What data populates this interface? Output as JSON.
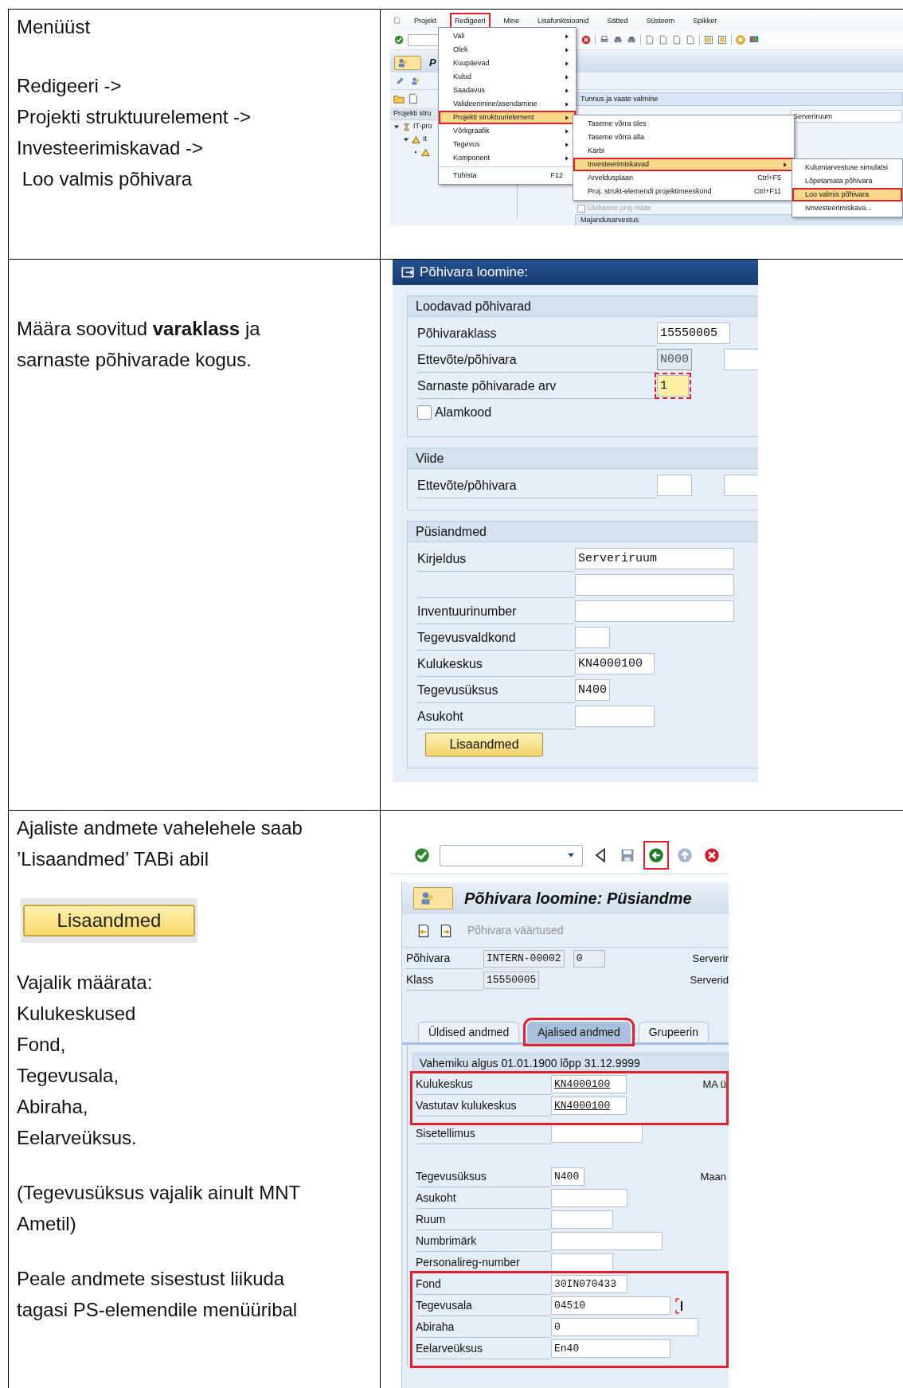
{
  "table": {
    "rows": [
      {
        "instruction": {
          "blocks": [
            {
              "kind": "paragraph",
              "lines": [
                "Menüüst"
              ]
            },
            {
              "kind": "paragraph",
              "lines": [
                "Redigeeri ->",
                "Projekti struktuurelement ->",
                "Investeerimiskavad ->",
                " Loo valmis põhivara"
              ]
            }
          ]
        },
        "screenshot": {
          "kind": "menu_path",
          "menubar": [
            {
              "label": "Projekt",
              "highlighted": false
            },
            {
              "label": "Redigeeri",
              "highlighted": true
            },
            {
              "label": "Mine",
              "highlighted": false
            },
            {
              "label": "Lisafunktsioonid",
              "highlighted": false
            },
            {
              "label": "Sätted",
              "highlighted": false
            },
            {
              "label": "Süsteem",
              "highlighted": false
            },
            {
              "label": "Spikker",
              "highlighted": false
            }
          ],
          "title_fragment": "P",
          "tab_label": "Tunnus ja vaate valmine",
          "tree_header": "Projekti stru",
          "tree": [
            {
              "kind": "node",
              "label": "IT-pro",
              "expanded": true,
              "children": [
                {
                  "kind": "node",
                  "label": "It",
                  "expanded": true,
                  "children": [
                    {
                      "kind": "leaf"
                    }
                  ]
                }
              ]
            }
          ],
          "field_value": "Serveriruum",
          "checkbox": {
            "label": "Ülekanne proj-määr.",
            "checked": false
          },
          "section_header": "Majandusarvestus",
          "menus": [
            {
              "items": [
                {
                  "kind": "item",
                  "label": "Vali",
                  "submenu": true,
                  "selected": false,
                  "highlighted": false
                },
                {
                  "kind": "item",
                  "label": "Olek",
                  "submenu": true,
                  "selected": false,
                  "highlighted": false
                },
                {
                  "kind": "item",
                  "label": "Kuupäevad",
                  "submenu": true,
                  "selected": false,
                  "highlighted": false
                },
                {
                  "kind": "item",
                  "label": "Kulud",
                  "submenu": true,
                  "selected": false,
                  "highlighted": false
                },
                {
                  "kind": "item",
                  "label": "Saadavus",
                  "submenu": true,
                  "selected": false,
                  "highlighted": false
                },
                {
                  "kind": "item",
                  "label": "Valideerimine/asendamine",
                  "submenu": true,
                  "selected": false,
                  "highlighted": false
                },
                {
                  "kind": "item",
                  "label": "Projekti struktuurielement",
                  "submenu": true,
                  "selected": true,
                  "highlighted": true
                },
                {
                  "kind": "item",
                  "label": "Võrkgraafik",
                  "submenu": true,
                  "selected": false,
                  "highlighted": false
                },
                {
                  "kind": "item",
                  "label": "Tegevus",
                  "submenu": true,
                  "selected": false,
                  "highlighted": false
                },
                {
                  "kind": "item",
                  "label": "Komponent",
                  "submenu": true,
                  "selected": false,
                  "highlighted": false
                },
                {
                  "kind": "separator"
                },
                {
                  "kind": "item",
                  "label": "Tühista",
                  "shortcut": "F12",
                  "submenu": false,
                  "selected": false,
                  "highlighted": false
                }
              ]
            },
            {
              "items": [
                {
                  "kind": "item",
                  "label": "Taseme võrra üles",
                  "submenu": false,
                  "selected": false,
                  "highlighted": false
                },
                {
                  "kind": "item",
                  "label": "Taseme võrra alla",
                  "submenu": false,
                  "selected": false,
                  "highlighted": false
                },
                {
                  "kind": "item",
                  "label": "Kärbi",
                  "submenu": false,
                  "selected": false,
                  "highlighted": false
                },
                {
                  "kind": "item",
                  "label": "Investeerimiskavad",
                  "submenu": true,
                  "selected": true,
                  "highlighted": true
                },
                {
                  "kind": "item",
                  "label": "Arveldusplaan",
                  "shortcut": "Ctrl+F5",
                  "submenu": false,
                  "selected": false,
                  "highlighted": false
                },
                {
                  "kind": "item",
                  "label": "Proj. strukt-elemendi projektimeeskond",
                  "shortcut": "Ctrl+F11",
                  "submenu": false,
                  "selected": false,
                  "highlighted": false
                }
              ]
            },
            {
              "items": [
                {
                  "kind": "item",
                  "label": "Kulumiarvestuse simulatsi",
                  "submenu": false,
                  "selected": false,
                  "highlighted": false
                },
                {
                  "kind": "item",
                  "label": "Lõpetamata põhivara",
                  "submenu": false,
                  "selected": false,
                  "highlighted": false
                },
                {
                  "kind": "item",
                  "label": "Loo valmis põhivara",
                  "submenu": false,
                  "selected": true,
                  "highlighted": true
                },
                {
                  "kind": "item",
                  "label": "Ivnvesteerimiskava...",
                  "submenu": false,
                  "selected": false,
                  "highlighted": false
                }
              ]
            }
          ]
        }
      },
      {
        "instruction": {
          "blocks": [
            {
              "kind": "paragraph",
              "lines": [
                "Määra soovitud **varaklass** ja sarnaste põhivarade kogus."
              ]
            }
          ]
        },
        "screenshot": {
          "kind": "create_dialog",
          "title": "Põhivara loomine:",
          "groups": [
            {
              "title": "Loodavad põhivarad",
              "rows": [
                {
                  "kind": "field",
                  "label": "Põhivaraklass",
                  "fields": [
                    {
                      "value": "15550005",
                      "readonly": false,
                      "focused": false
                    }
                  ]
                },
                {
                  "kind": "field",
                  "label": "Ettevõte/põhivara",
                  "fields": [
                    {
                      "value": "N000",
                      "readonly": true,
                      "focused": false
                    },
                    {
                      "readonly": false,
                      "focused": false
                    }
                  ]
                },
                {
                  "kind": "field",
                  "label": "Sarnaste põhivarade arv",
                  "fields": [
                    {
                      "value": "1",
                      "readonly": false,
                      "focused": true
                    }
                  ]
                },
                {
                  "kind": "checkbox",
                  "label": "Alamkood",
                  "checked": false
                }
              ]
            },
            {
              "title": "Viide",
              "rows": [
                {
                  "kind": "field",
                  "label": "Ettevõte/põhivara",
                  "fields": [
                    {
                      "readonly": false,
                      "focused": false
                    },
                    {
                      "readonly": false,
                      "focused": false
                    }
                  ]
                }
              ]
            },
            {
              "title": "Püsiandmed",
              "rows": [
                {
                  "kind": "field",
                  "label": "Kirjeldus",
                  "fields": [
                    {
                      "value": "Serveriruum",
                      "readonly": false,
                      "focused": false
                    }
                  ]
                },
                {
                  "kind": "field",
                  "fields": [
                    {
                      "readonly": false,
                      "focused": false
                    }
                  ]
                },
                {
                  "kind": "field",
                  "label": "Inventuurinumber",
                  "fields": [
                    {
                      "readonly": false,
                      "focused": false
                    }
                  ]
                },
                {
                  "kind": "field",
                  "label": "Tegevusvaldkond",
                  "fields": [
                    {
                      "readonly": false,
                      "focused": false
                    }
                  ]
                },
                {
                  "kind": "field",
                  "label": "Kulukeskus",
                  "fields": [
                    {
                      "value": "KN4000100",
                      "readonly": false,
                      "focused": false
                    }
                  ]
                },
                {
                  "kind": "field",
                  "label": "Tegevusüksus",
                  "fields": [
                    {
                      "value": "N400",
                      "readonly": false,
                      "focused": false
                    }
                  ]
                },
                {
                  "kind": "field",
                  "label": "Asukoht",
                  "fields": [
                    {
                      "readonly": false,
                      "focused": false
                    }
                  ]
                }
              ]
            }
          ],
          "button": "Lisaandmed"
        }
      },
      {
        "instruction": {
          "blocks": [
            {
              "kind": "paragraph",
              "lines": [
                "Ajaliste andmete vahelehele saab ’Lisaandmed’ TABi abil"
              ]
            },
            {
              "kind": "button_image",
              "label": "Lisaandmed"
            },
            {
              "kind": "paragraph",
              "lines": [
                "Vajalik määrata:",
                "Kulukeskused",
                "Fond,",
                "Tegevusala,",
                "Abiraha,",
                "Eelarveüksus."
              ]
            },
            {
              "kind": "paragraph",
              "lines": [
                "(Tegevusüksus vajalik ainult MNT Ametil)"
              ]
            },
            {
              "kind": "paragraph",
              "lines": [
                "Peale andmete sisestust liikuda tagasi PS-elemendile menüüribal"
              ]
            }
          ]
        },
        "screenshot": {
          "kind": "detail_screen",
          "toolbar": [
            {
              "kind": "enter",
              "highlighted": false
            },
            {
              "kind": "command_field",
              "highlighted": false
            },
            {
              "kind": "previous",
              "highlighted": false
            },
            {
              "kind": "save",
              "highlighted": false
            },
            {
              "kind": "back",
              "highlighted": true
            },
            {
              "kind": "exit",
              "highlighted": false
            },
            {
              "kind": "cancel",
              "highlighted": false
            }
          ],
          "title": "Põhivara loomine:  Püsiandme",
          "subtoolbar_label": "Põhivara väärtused",
          "header_rows": [
            {
              "label": "Põhivara",
              "fields": [
                "INTERN-00002",
                "0"
              ],
              "side_text": "Serverir"
            },
            {
              "label": "Klass",
              "fields": [
                "15550005"
              ],
              "side_text": "Serverid"
            }
          ],
          "tabs": [
            {
              "label": "Üldised andmed",
              "selected": false,
              "highlighted": false
            },
            {
              "label": "Ajalised andmed",
              "selected": true,
              "highlighted": true
            },
            {
              "label": "Grupeerin",
              "selected": false,
              "highlighted": false
            }
          ],
          "range_header": "Vahemiku algus 01.01.1900 lõpp 31.12.9999",
          "groups": [
            {
              "highlighted": true,
              "rows": [
                {
                  "label": "Kulukeskus",
                  "value": "KN4000100",
                  "side_text": "MA ü",
                  "cursor": false
                },
                {
                  "label": "Vastutav kulukeskus",
                  "value": "KN4000100",
                  "cursor": false
                }
              ]
            },
            {
              "highlighted": false,
              "rows": [
                {
                  "label": "Sisetellimus",
                  "cursor": false
                }
              ]
            },
            {
              "highlighted": false,
              "rows": [
                {
                  "label": "Tegevusüksus",
                  "value": "N400",
                  "side_text": "Maan",
                  "cursor": false
                },
                {
                  "label": "Asukoht",
                  "cursor": false
                },
                {
                  "label": "Ruum",
                  "cursor": false
                },
                {
                  "label": "Numbrimärk",
                  "cursor": false
                },
                {
                  "label": "Personalireg-number",
                  "cursor": false
                }
              ]
            },
            {
              "highlighted": true,
              "rows": [
                {
                  "label": "Fond",
                  "value": "30IN070433",
                  "cursor": false
                },
                {
                  "label": "Tegevusala",
                  "value": "04510",
                  "cursor": true
                },
                {
                  "label": "Abiraha",
                  "value": "0",
                  "cursor": false
                },
                {
                  "label": "Eelarveüksus",
                  "value": "En40",
                  "cursor": false
                }
              ]
            }
          ]
        }
      }
    ]
  }
}
